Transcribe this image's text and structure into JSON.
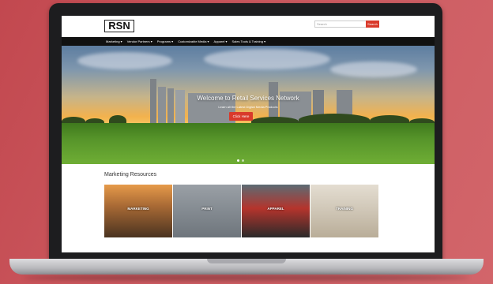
{
  "site": {
    "logo_text": "RSN",
    "search_placeholder": "Search",
    "search_button": "Search"
  },
  "nav": {
    "items": [
      {
        "label": "Marketing ▾"
      },
      {
        "label": "Vendor Partners ▾"
      },
      {
        "label": "Programs ▾"
      },
      {
        "label": "Customizable Media ▾"
      },
      {
        "label": "Apparel ▾"
      },
      {
        "label": "Sales Tools & Training ▾"
      }
    ]
  },
  "hero": {
    "title": "Welcome to Retail Services Network",
    "subtitle": "Learn all the Latest Digital Media Products",
    "button": "Click Here",
    "slide_count": 2,
    "active_slide": 1
  },
  "resources": {
    "title": "Marketing Resources",
    "cards": [
      {
        "label": "MARKETING"
      },
      {
        "label": "PRINT"
      },
      {
        "label": "APPAREL"
      },
      {
        "label": "TRAINING"
      }
    ]
  },
  "colors": {
    "background": "#c9555c",
    "accent": "#d93a2b",
    "nav": "#111111"
  }
}
